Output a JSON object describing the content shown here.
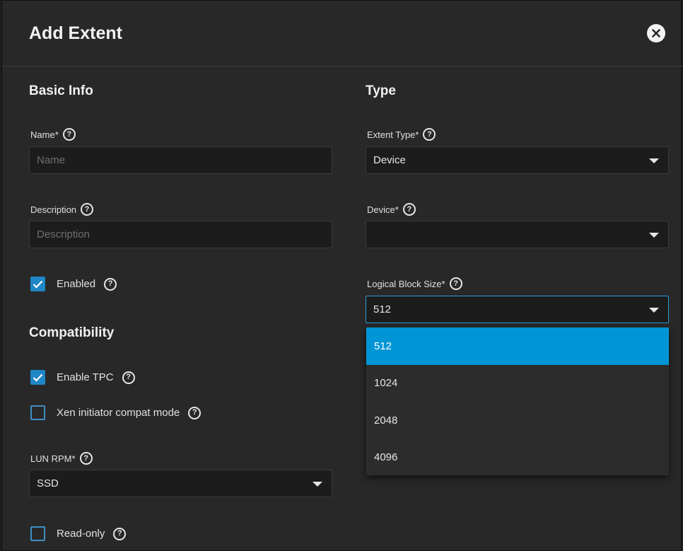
{
  "dialog": {
    "title": "Add Extent",
    "close_icon": "close-icon"
  },
  "basic_info": {
    "title": "Basic Info",
    "name": {
      "label": "Name",
      "required": "*",
      "placeholder": "Name",
      "value": ""
    },
    "description": {
      "label": "Description",
      "placeholder": "Description",
      "value": ""
    },
    "enabled": {
      "label": "Enabled",
      "checked": true
    }
  },
  "compatibility": {
    "title": "Compatibility",
    "enable_tpc": {
      "label": "Enable TPC",
      "checked": true
    },
    "xen_compat": {
      "label": "Xen initiator compat mode",
      "checked": false
    },
    "lun_rpm": {
      "label": "LUN RPM",
      "required": "*",
      "value": "SSD"
    },
    "read_only": {
      "label": "Read-only",
      "checked": false
    }
  },
  "type": {
    "title": "Type",
    "extent_type": {
      "label": "Extent Type",
      "required": "*",
      "value": "Device"
    },
    "device": {
      "label": "Device",
      "required": "*",
      "value": ""
    },
    "logical_block_size": {
      "label": "Logical Block Size",
      "required": "*",
      "value": "512",
      "options": [
        "512",
        "1024",
        "2048",
        "4096"
      ],
      "selected_index": 0
    }
  },
  "icons": {
    "help": "?",
    "check": "check-icon",
    "dropdown": "chevron-down-icon"
  },
  "colors": {
    "accent": "#0095d5",
    "checkbox": "#1f86c6",
    "background": "#282828"
  }
}
